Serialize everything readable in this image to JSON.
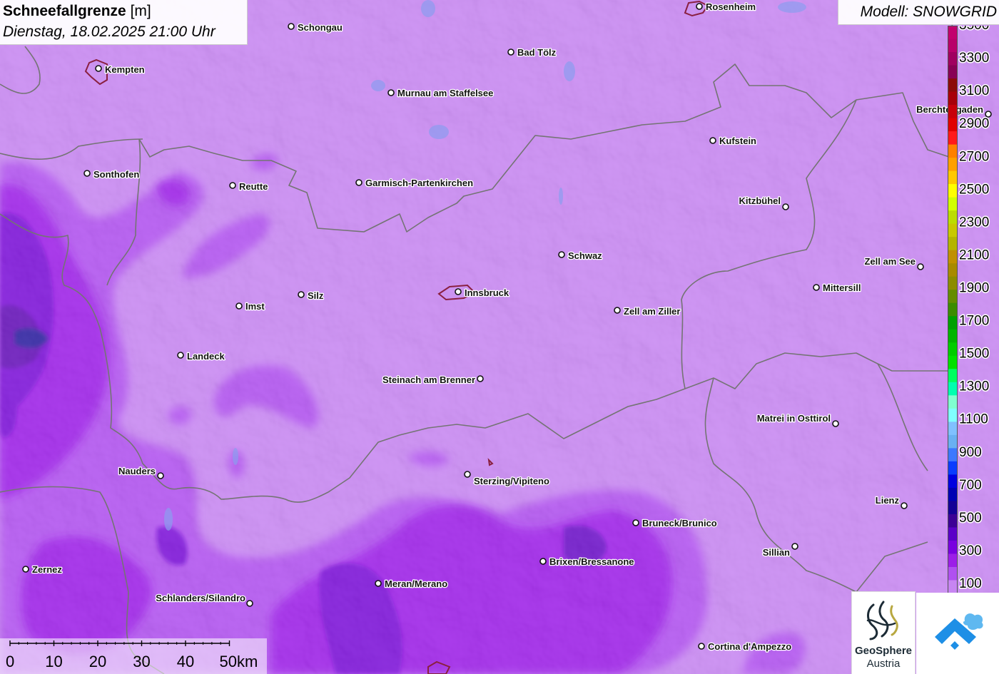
{
  "title": {
    "main": "Schneefallgrenze",
    "unit": "[m]",
    "datetime": "Dienstag, 18.02.2025 21:00 Uhr"
  },
  "model": {
    "label": "Modell: SNOWGRID"
  },
  "legend": {
    "labels": [
      "3500",
      "3300",
      "3100",
      "2900",
      "2700",
      "2500",
      "2300",
      "2100",
      "1900",
      "1700",
      "1500",
      "1300",
      "1100",
      "900",
      "700",
      "500",
      "300",
      "100"
    ],
    "colors": [
      "#c2006e",
      "#b8006a",
      "#a00060",
      "#880055",
      "#8c0a0a",
      "#a8000a",
      "#c8000a",
      "#e00000",
      "#ff1a1a",
      "#ff8000",
      "#ffa000",
      "#ffc800",
      "#ffff00",
      "#d2ff00",
      "#bcdc00",
      "#c8c800",
      "#b4b400",
      "#c09000",
      "#a88a00",
      "#8c8c00",
      "#648c00",
      "#3c8c00",
      "#00a000",
      "#00b400",
      "#00cc00",
      "#00e000",
      "#00ff60",
      "#00ffb0",
      "#80ffd0",
      "#80ffff",
      "#80c0ff",
      "#6ab0f2",
      "#3c78ff",
      "#0a3cff",
      "#0000e0",
      "#0000b4",
      "#140096",
      "#3c0096",
      "#5a00c8",
      "#7800e0",
      "#9c1ee8",
      "#b050f0",
      "#c785f2"
    ]
  },
  "cities": [
    {
      "name": "Rosenheim"
    },
    {
      "name": "Schongau"
    },
    {
      "name": "Bad Tölz"
    },
    {
      "name": "Kempten"
    },
    {
      "name": "Murnau am Staffelsee"
    },
    {
      "name": "Berchtesgaden"
    },
    {
      "name": "Kufstein"
    },
    {
      "name": "Sonthofen"
    },
    {
      "name": "Reutte"
    },
    {
      "name": "Garmisch-Partenkirchen"
    },
    {
      "name": "Kitzbühel"
    },
    {
      "name": "Schwaz"
    },
    {
      "name": "Zell am See"
    },
    {
      "name": "Mittersill"
    },
    {
      "name": "Silz"
    },
    {
      "name": "Innsbruck"
    },
    {
      "name": "Imst"
    },
    {
      "name": "Zell am Ziller"
    },
    {
      "name": "Landeck"
    },
    {
      "name": "Steinach am Brenner"
    },
    {
      "name": "Matrei in Osttirol"
    },
    {
      "name": "Nauders"
    },
    {
      "name": "Sterzing/Vipiteno"
    },
    {
      "name": "Lienz"
    },
    {
      "name": "Bruneck/Brunico"
    },
    {
      "name": "Sillian"
    },
    {
      "name": "Brixen/Bressanone"
    },
    {
      "name": "Zernez"
    },
    {
      "name": "Meran/Merano"
    },
    {
      "name": "Schlanders/Silandro"
    },
    {
      "name": "Cortina d'Ampezzo"
    }
  ],
  "scale": {
    "ticks": [
      "0",
      "10",
      "20",
      "30",
      "40",
      "50km"
    ]
  },
  "logos": {
    "geosphere_line1": "GeoSphere",
    "geosphere_line2": "Austria"
  },
  "icons": {
    "geosphere_logo": "geosphere-logo-icon",
    "cloud_logo": "cloud-logo-icon"
  }
}
